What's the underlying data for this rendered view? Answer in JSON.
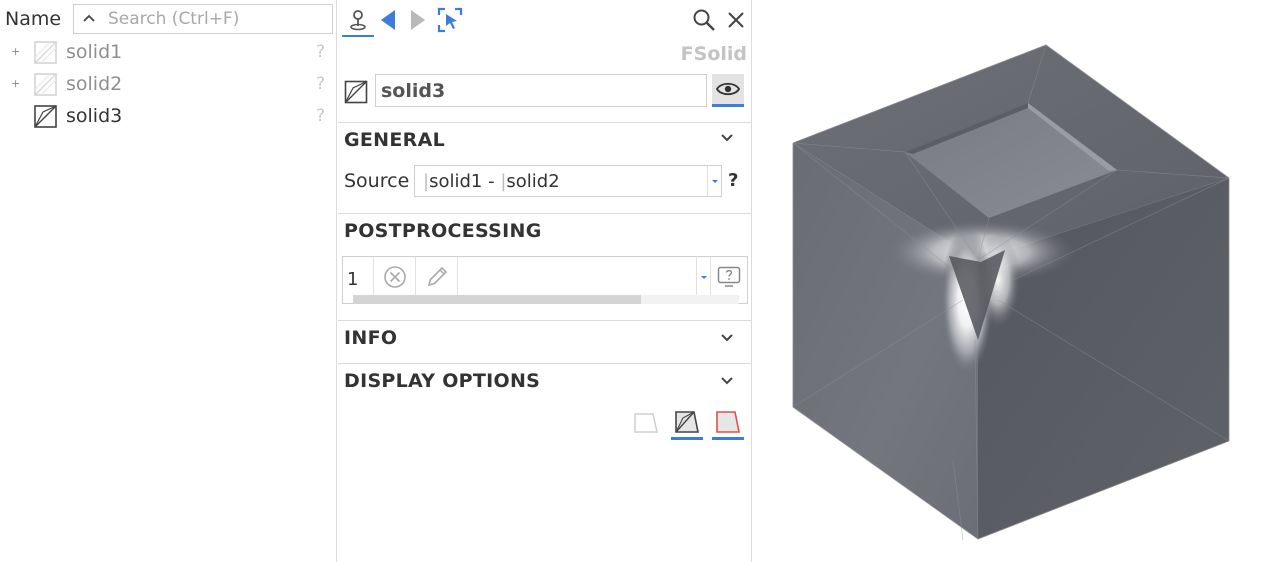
{
  "tree": {
    "column_header": "Name",
    "search_placeholder": "Search (Ctrl+F)",
    "items": [
      {
        "label": "solid1",
        "expander": "+",
        "help": "?"
      },
      {
        "label": "solid2",
        "expander": "+",
        "help": "?"
      },
      {
        "label": "solid3",
        "expander": "",
        "help": "?"
      }
    ]
  },
  "properties": {
    "type_label": "FSolid",
    "name_value": "solid3",
    "sections": {
      "general": "GENERAL",
      "postprocessing": "POSTPROCESSING",
      "info": "INFO",
      "display_options": "DISPLAY OPTIONS"
    },
    "source_label": "Source",
    "source_value": {
      "part1": "solid1",
      "operator": "-",
      "part2": "solid2"
    },
    "source_help": "?",
    "postprocessing_index": "1"
  },
  "icons": {
    "toolbar": [
      "pin-icon",
      "back-arrow-icon",
      "forward-arrow-icon",
      "select-target-icon",
      "search-icon",
      "close-icon"
    ],
    "accent_color": "#3b7dd8",
    "disabled_color": "#c4c4c4"
  },
  "viewport": {
    "model": "cube-with-pocket"
  }
}
